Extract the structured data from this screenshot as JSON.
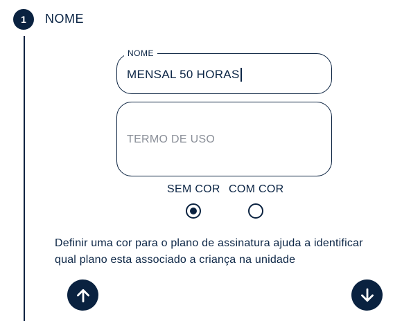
{
  "step": {
    "number": "1",
    "title": "NOME"
  },
  "form": {
    "nome_label": "NOME",
    "nome_value": "MENSAL 50 HORAS",
    "termo_placeholder": "TERMO DE USO"
  },
  "color_option": {
    "options": [
      {
        "label": "SEM COR",
        "selected": true
      },
      {
        "label": "COM COR",
        "selected": false
      }
    ]
  },
  "help_text": "Definir uma cor para o plano de assinatura ajuda a identificar\n qual plano esta associado a criança na unidade",
  "icons": {
    "up": "arrow-up-icon",
    "down": "arrow-down-icon"
  },
  "colors": {
    "primary": "#0a2240",
    "placeholder": "#8a8f98"
  }
}
